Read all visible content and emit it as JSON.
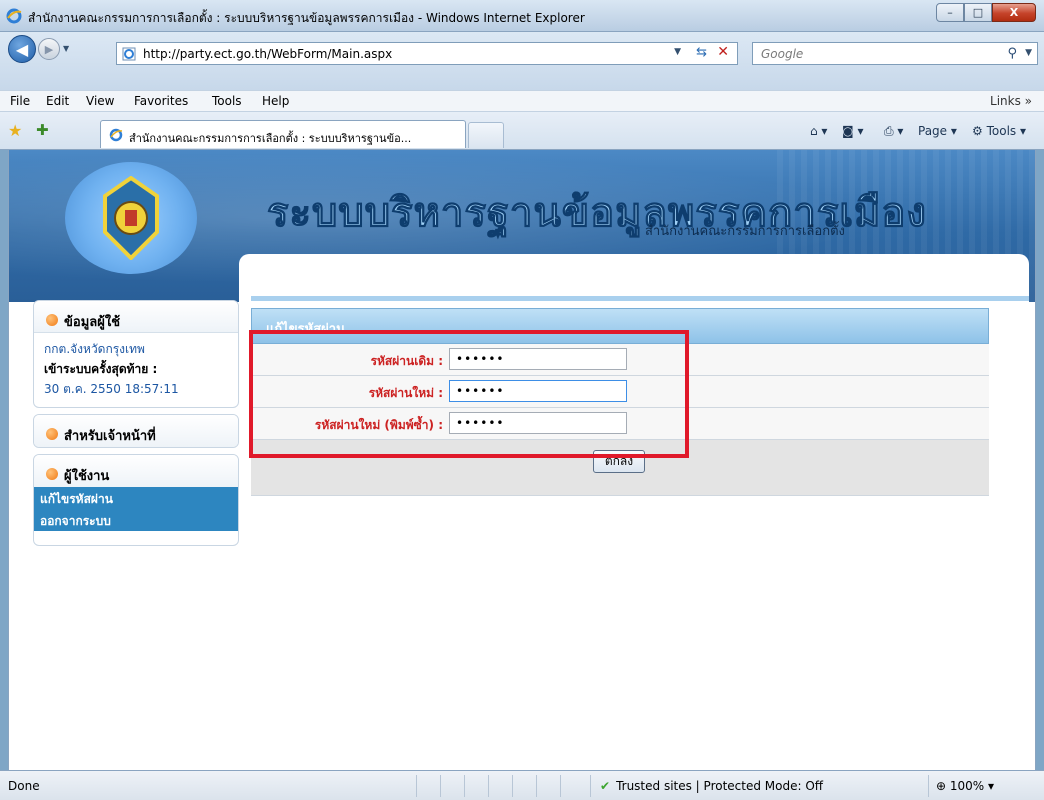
{
  "window": {
    "title": "สำนักงานคณะกรรมการการเลือกตั้ง : ระบบบริหารฐานข้อมูลพรรคการเมือง - Windows Internet Explorer",
    "minimize": "–",
    "maximize": "□",
    "close": "X"
  },
  "address_bar": {
    "url": "http://party.ect.go.th/WebForm/Main.aspx",
    "search_placeholder": "Google"
  },
  "menu": {
    "file": "File",
    "edit": "Edit",
    "view": "View",
    "favorites": "Favorites",
    "tools": "Tools",
    "help": "Help",
    "links": "Links »"
  },
  "tabs": {
    "active_label": "สำนักงานคณะกรรมการการเลือกตั้ง : ระบบบริหารฐานข้อ..."
  },
  "command_bar": {
    "page": "Page ▾",
    "tools": "Tools ▾"
  },
  "banner": {
    "title": "ระบบบริหารฐานข้อมูลพรรคการเมือง",
    "subtitle": "สำนักงานคณะกรรมการการเลือกตั้ง"
  },
  "sidebar": {
    "user_info": {
      "heading": "ข้อมูลผู้ใช้",
      "username": "กกต.จังหวัดกรุงเทพ",
      "last_login_label": "เข้าระบบครั้งสุดท้าย :",
      "last_login_value": "30 ต.ค. 2550 18:57:11"
    },
    "staff": {
      "heading": "สำหรับเจ้าหน้าที่"
    },
    "users": {
      "heading": "ผู้ใช้งาน",
      "items": [
        "แก้ไขรหัสผ่าน",
        "ออกจากระบบ"
      ]
    }
  },
  "form": {
    "heading": "แก้ไขรหัสผ่าน",
    "fields": [
      {
        "label": "รหัสผ่านเดิม :",
        "value": "••••••"
      },
      {
        "label": "รหัสผ่านใหม่ :",
        "value": "••••••"
      },
      {
        "label": "รหัสผ่านใหม่ (พิมพ์ซ้ำ) :",
        "value": "••••••"
      }
    ],
    "submit_label": "ตกลง"
  },
  "status_bar": {
    "status": "Done",
    "zone": "Trusted sites | Protected Mode: Off",
    "zoom": "100%"
  },
  "colors": {
    "accent": "#2d86c0",
    "label_red": "#cc2222",
    "highlight_box": "#e0192a",
    "banner_blue": "#2f6aa6"
  }
}
